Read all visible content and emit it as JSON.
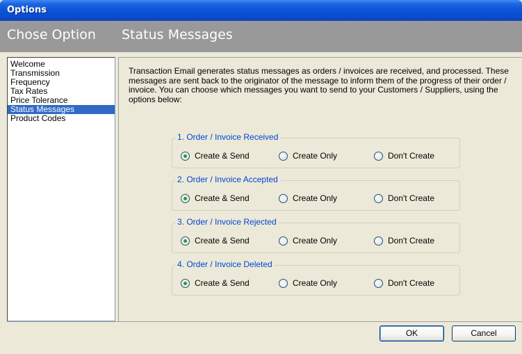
{
  "window": {
    "title": "Options"
  },
  "header": {
    "left_title": "Chose Option",
    "right_title": "Status Messages"
  },
  "sidebar": {
    "items": [
      {
        "label": "Welcome",
        "selected": false
      },
      {
        "label": "Transmission",
        "selected": false
      },
      {
        "label": "Frequency",
        "selected": false
      },
      {
        "label": "Tax Rates",
        "selected": false
      },
      {
        "label": "Price Tolerance",
        "selected": false
      },
      {
        "label": "Status Messages",
        "selected": true
      },
      {
        "label": "Product Codes",
        "selected": false
      }
    ]
  },
  "main": {
    "intro_text": "Transaction Email generates status messages as orders / invoices are received, and processed. These messages are sent back to the originator of the message to inform them of the progress of their order / invoice. You can choose which messages you want to send to your Customers / Suppliers, using the options below:",
    "groups": [
      {
        "title": "1. Order / Invoice Received",
        "options": [
          "Create & Send",
          "Create Only",
          "Don't Create"
        ],
        "selected": "Create & Send"
      },
      {
        "title": "2. Order / Invoice Accepted",
        "options": [
          "Create & Send",
          "Create Only",
          "Don't Create"
        ],
        "selected": "Create & Send"
      },
      {
        "title": "3. Order / Invoice Rejected",
        "options": [
          "Create & Send",
          "Create Only",
          "Don't Create"
        ],
        "selected": "Create & Send"
      },
      {
        "title": "4. Order / Invoice Deleted",
        "options": [
          "Create & Send",
          "Create Only",
          "Don't Create"
        ],
        "selected": "Create & Send"
      }
    ]
  },
  "footer": {
    "ok_label": "OK",
    "cancel_label": "Cancel"
  },
  "colors": {
    "titlebar": "#0b53d8",
    "header_band": "#999999",
    "selection": "#316ac5",
    "group_title": "#0046d5",
    "radio_dot": "#21a121"
  }
}
